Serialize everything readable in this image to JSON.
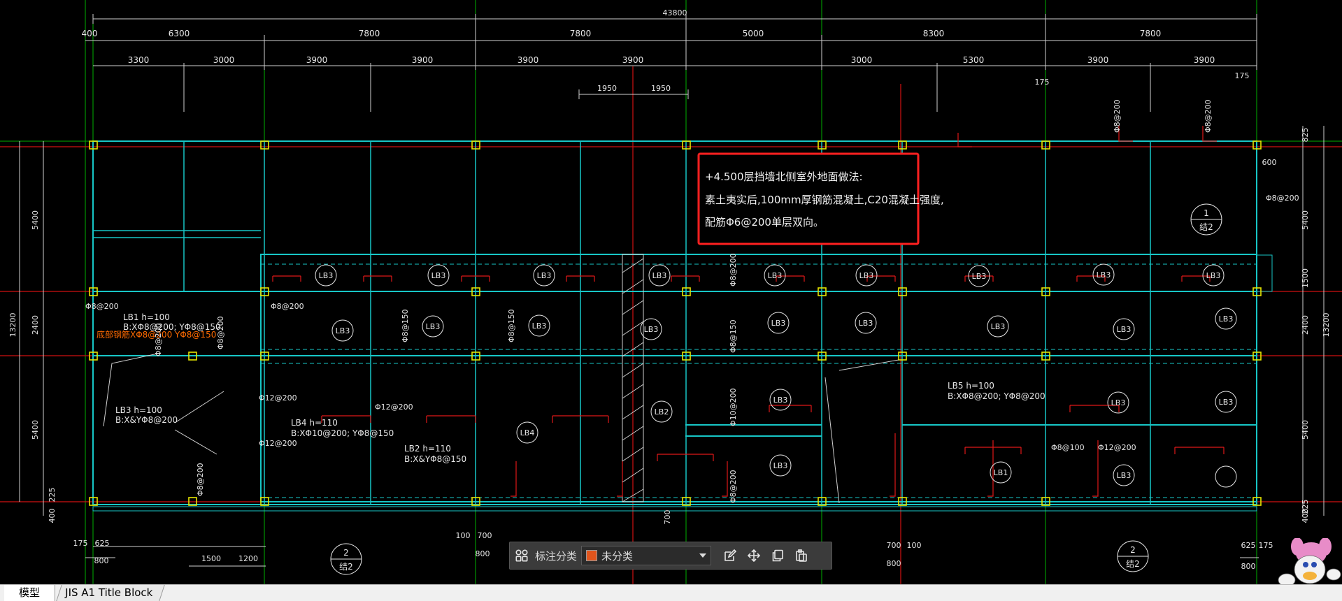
{
  "drawing": {
    "overall_dim": "43800",
    "top_dims_row1": [
      "400",
      "6300",
      "7800",
      "7800",
      "5000",
      "8300",
      "7800"
    ],
    "top_dims_row2": [
      "3300",
      "3000",
      "3900",
      "3900",
      "3900",
      "3900",
      "3000",
      "5300",
      "3900",
      "3900"
    ],
    "top_dims_row3": [
      "1950",
      "1950",
      "175",
      "175"
    ],
    "left_dims_outer": [
      "13200"
    ],
    "left_dims_inner": [
      "5400",
      "2400",
      "5400",
      "225",
      "400"
    ],
    "right_dims_outer": [
      "13200"
    ],
    "right_dims_inner": [
      "825",
      "600",
      "5400",
      "1500",
      "2400",
      "5400",
      "225",
      "400"
    ],
    "bottom_dims": [
      "175",
      "625",
      "800",
      "1500",
      "1200",
      "100",
      "700",
      "800",
      "700",
      "700",
      "800",
      "100",
      "625",
      "175",
      "800"
    ],
    "slab_labels": [
      "LB3",
      "LB3",
      "LB3",
      "LB3",
      "LB3",
      "LB3",
      "LB3",
      "LB3",
      "LB3",
      "LB3",
      "LB3",
      "LB3",
      "LB3",
      "LB3",
      "LB3",
      "LB3",
      "LB3",
      "LB3",
      "LB3",
      "LB3",
      "LB3",
      "LB3",
      "LB3",
      "LB2",
      "LB4",
      "LB1"
    ],
    "slab_notes": [
      "LB1  h=100",
      "B:XΦ8@200; YΦ8@150",
      "LB3  h=100",
      "B:X&YΦ8@200",
      "LB4  h=110",
      "B:XΦ10@200; YΦ8@150",
      "LB2  h=110",
      "B:X&YΦ8@150",
      "LB5  h=100",
      "B:XΦ8@200; YΦ8@200"
    ],
    "orange_note": "底部钢筋XΦ8@200 YΦ8@150",
    "rebar_labels": [
      "Φ8@200",
      "Φ8@200",
      "Φ12@200",
      "Φ12@200",
      "Φ12@200",
      "Φ12@200",
      "Φ8@150",
      "Φ8@150",
      "Φ8@150",
      "Φ8@200",
      "Φ8@200",
      "Φ8@200",
      "Φ8@200",
      "Φ8@200",
      "Φ8@200",
      "Φ8@100",
      "Φ8@200",
      "Φ10@200",
      "Φ8@200"
    ],
    "section_marks": [
      {
        "num": "1",
        "ref": "结2"
      },
      {
        "num": "2",
        "ref": "结2"
      },
      {
        "num": "2",
        "ref": "结2"
      }
    ],
    "note_box": {
      "line1": "+4.500层挡墙北侧室外地面做法:",
      "line2": "素土夷实后,100mm厚钢筋混凝土,C20混凝土强度,",
      "line3": "配筋Φ6@200单层双向。"
    }
  },
  "toolbar": {
    "category_label": "标注分类",
    "category_value": "未分类",
    "category_color": "#e0541c",
    "icons": [
      "grid-view-icon",
      "edit-icon",
      "move-icon",
      "copy-icon",
      "paste-icon"
    ]
  },
  "tabs": {
    "model": "模型",
    "layout": "JIS A1 Title Block"
  },
  "colors": {
    "background": "#000000",
    "axis_green": "#00c800",
    "axis_red": "#e01010",
    "beam_cyan": "#17c6c6",
    "dim_white": "#d9d9d9",
    "column_yellow": "#e6e600",
    "rebar_red": "#e01818",
    "highlight_box": "#ff2222",
    "orange": "#ff6a00"
  }
}
